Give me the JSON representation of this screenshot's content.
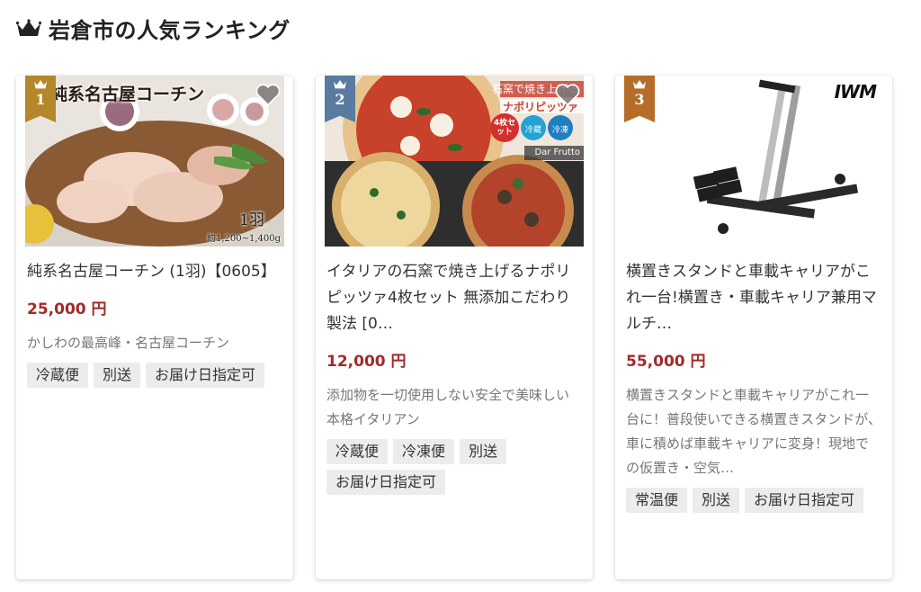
{
  "section": {
    "title": "岩倉市の人気ランキング",
    "crown_icon": "crown-icon"
  },
  "colors": {
    "price": "#a32a2a",
    "rank1": "#b3872a",
    "rank2": "#5a7ba0",
    "rank3": "#b56d29"
  },
  "cards": [
    {
      "rank": "1",
      "image_text": {
        "headline": "純系名古屋コーチン",
        "count": "1羽",
        "weight": "約1,200~1,400g"
      },
      "title": "純系名古屋コーチン (1羽)【0605】",
      "price": "25,000 円",
      "description": "かしわの最高峰・名古屋コーチン",
      "tags": [
        "冷蔵便",
        "別送",
        "お届け日指定可"
      ]
    },
    {
      "rank": "2",
      "image_text": {
        "headline": "石窯で焼き上げる",
        "subheadline": "ナポリピッツァ",
        "set": "4枚セット",
        "chilled": "冷蔵",
        "frozen": "冷凍",
        "brand": "Dar Frutto"
      },
      "title": "イタリアの石窯で焼き上げるナポリピッツァ4枚セット 無添加こだわり製法 [0…",
      "price": "12,000 円",
      "description": "添加物を一切使用しない安全で美味しい本格イタリアン",
      "tags": [
        "冷蔵便",
        "冷凍便",
        "別送",
        "お届け日指定可"
      ]
    },
    {
      "rank": "3",
      "image_text": {
        "brand": "IWM"
      },
      "title": "横置きスタンドと車載キャリアがこれ一台!横置き・車載キャリア兼用マルチ…",
      "price": "55,000 円",
      "description": "横置きスタンドと車載キャリアがこれ一台に！普段使いできる横置きスタンドが、車に積めば車載キャリアに変身！現地での仮置き・空気…",
      "tags": [
        "常温便",
        "別送",
        "お届け日指定可"
      ]
    }
  ]
}
